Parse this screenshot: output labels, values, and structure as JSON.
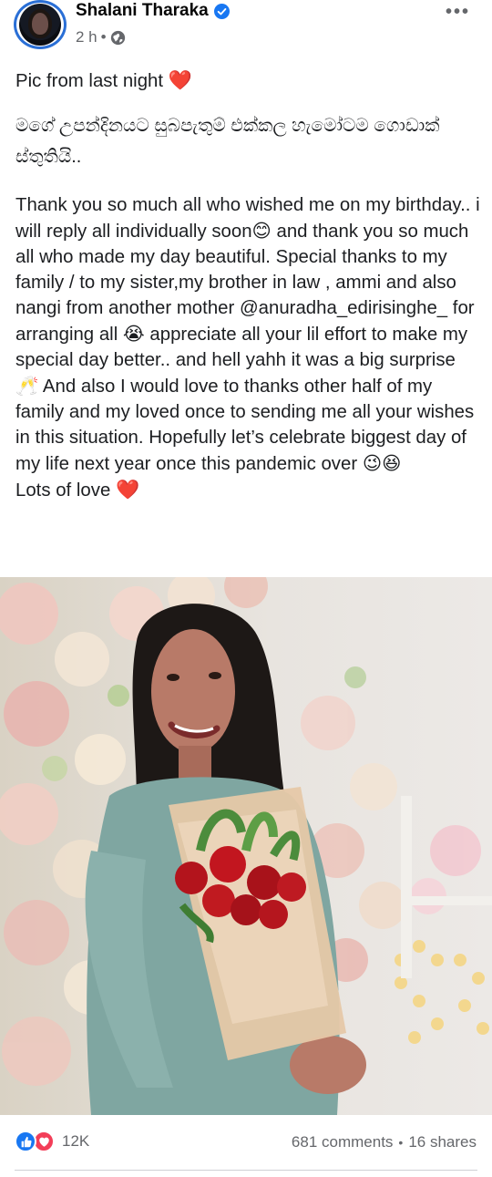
{
  "post": {
    "author": "Shalani Tharaka",
    "verified": true,
    "time": "2 h",
    "privacy_icon": "globe-icon",
    "more_icon": "more-options-icon",
    "text": {
      "line1": "Pic from last night",
      "line1_emoji": "❤️",
      "sinhala": "මගේ උපන්දිනයට සුබපැතුම් එක්කල හැමෝටම ගොඩාක් ස්තුතියි..",
      "body_1": "Thank you so much all who wished me on my birthday.. i will reply all individually soon",
      "emoji_smile": "😊",
      "body_2": " and thank you so much all who made my day beautiful. Special thanks to my family / to my sister,my brother in law , ammi and also nangi from another mother @anuradha_edirisinghe_  for arranging all ",
      "emoji_cry": "😭",
      "body_3": " appreciate all your lil effort to make my special day better.. and hell yahh it was a big surprise ",
      "emoji_cheers": "🥂",
      "body_4": " And also I would love to thanks other half of my family and my loved once to sending me all your wishes in this situation. Hopefully let’s celebrate biggest day of my life next year once this pandemic over ",
      "emoji_wink": "😉😆",
      "closing": "Lots of love",
      "closing_emoji": "❤️"
    }
  },
  "stats": {
    "reaction_icons": [
      "like-icon",
      "love-icon"
    ],
    "reactions_count": "12K",
    "comments": "681 comments",
    "shares": "16 shares"
  },
  "colors": {
    "accent": "#1877f2",
    "love": "#f33e58",
    "secondary_text": "#65676b"
  }
}
